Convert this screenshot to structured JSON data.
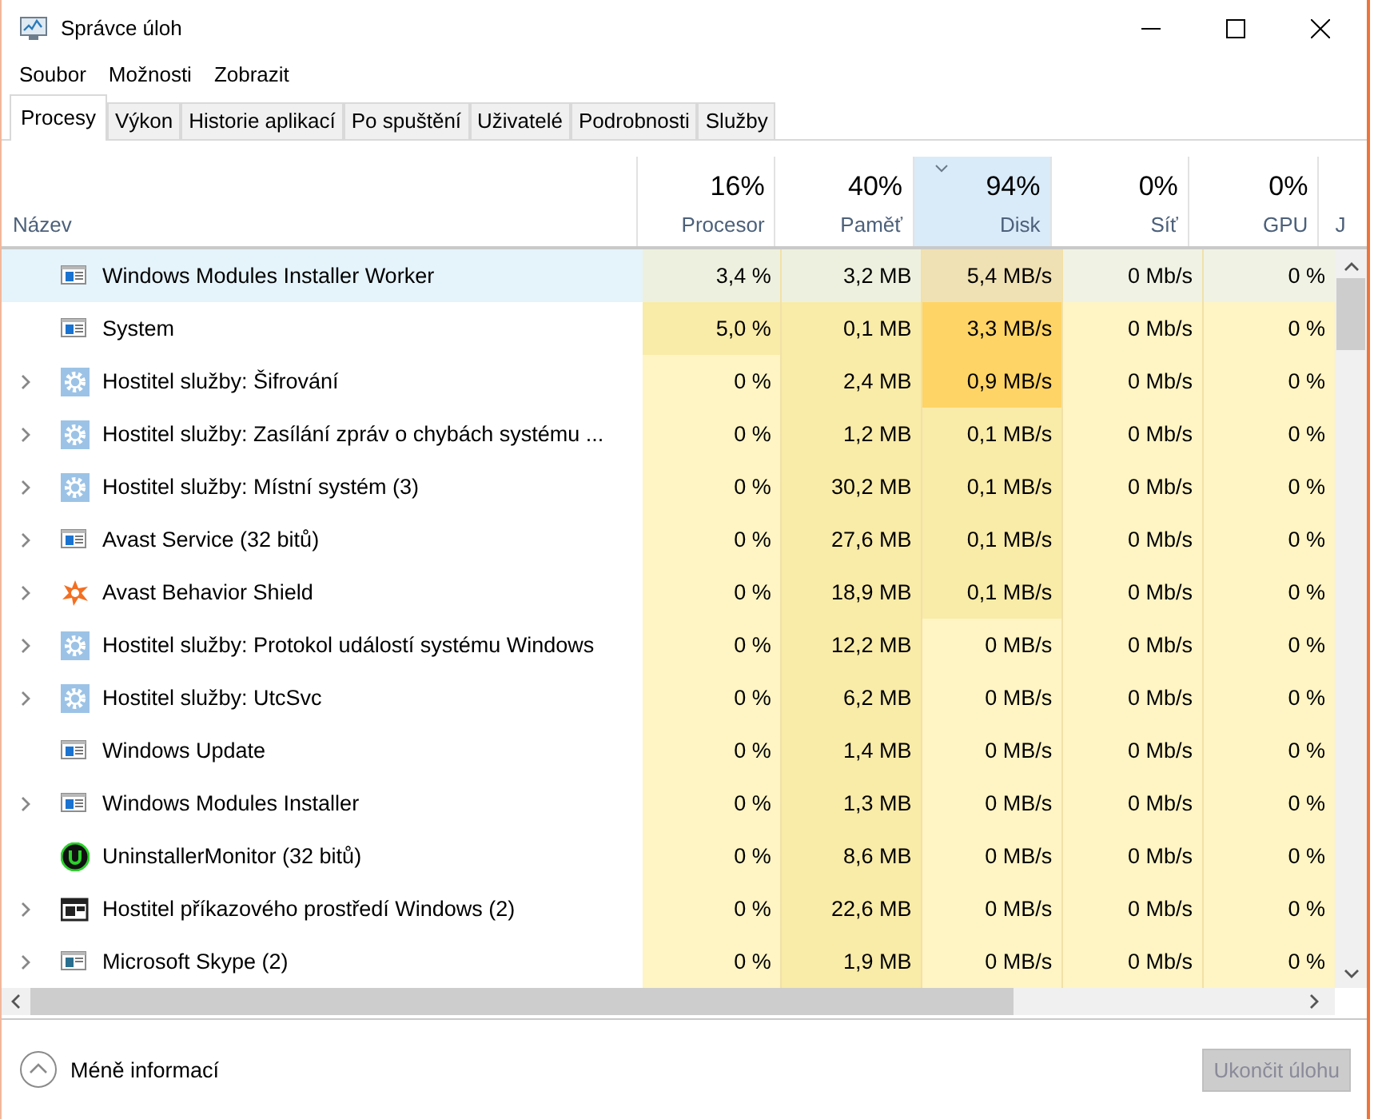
{
  "window": {
    "title": "Správce úloh"
  },
  "menu": [
    "Soubor",
    "Možnosti",
    "Zobrazit"
  ],
  "tabs": [
    {
      "label": "Procesy",
      "selected": true
    },
    {
      "label": "Výkon",
      "selected": false
    },
    {
      "label": "Historie aplikací",
      "selected": false
    },
    {
      "label": "Po spuštění",
      "selected": false
    },
    {
      "label": "Uživatelé",
      "selected": false
    },
    {
      "label": "Podrobnosti",
      "selected": false
    },
    {
      "label": "Služby",
      "selected": false
    }
  ],
  "table": {
    "name_column": "Název",
    "columns": [
      {
        "percent": "16%",
        "label": "Procesor",
        "sorted": false
      },
      {
        "percent": "40%",
        "label": "Paměť",
        "sorted": false
      },
      {
        "percent": "94%",
        "label": "Disk",
        "sorted": true
      },
      {
        "percent": "0%",
        "label": "Síť",
        "sorted": false
      },
      {
        "percent": "0%",
        "label": "GPU",
        "sorted": false
      }
    ],
    "column_7": "J",
    "rows": [
      {
        "name": "Windows Modules Installer Worker",
        "kind": "app",
        "expandable": false,
        "selected": true,
        "cells": [
          {
            "text": "3,4 %",
            "color": "#eef0df"
          },
          {
            "text": "3,2 MB",
            "color": "#eef0df"
          },
          {
            "text": "5,4 MB/s",
            "color": "#f0e1b4"
          },
          {
            "text": "0 Mb/s",
            "color": "#f0f2e4"
          },
          {
            "text": "0 %",
            "color": "#f0f2e4"
          }
        ]
      },
      {
        "name": "System",
        "kind": "app",
        "expandable": false,
        "selected": false,
        "cells": [
          {
            "text": "5,0 %",
            "color": "#f9eba8"
          },
          {
            "text": "0,1 MB",
            "color": "#f9eba8"
          },
          {
            "text": "3,3 MB/s",
            "color": "#ffd466"
          },
          {
            "text": "0 Mb/s",
            "color": "#fff4c4"
          },
          {
            "text": "0 %",
            "color": "#fff4c4"
          }
        ]
      },
      {
        "name": "Hostitel služby: Šifrování",
        "kind": "gear",
        "expandable": true,
        "selected": false,
        "cells": [
          {
            "text": "0 %",
            "color": "#fff4c4"
          },
          {
            "text": "2,4 MB",
            "color": "#f9eba8"
          },
          {
            "text": "0,9 MB/s",
            "color": "#ffd466"
          },
          {
            "text": "0 Mb/s",
            "color": "#fff4c4"
          },
          {
            "text": "0 %",
            "color": "#fff4c4"
          }
        ]
      },
      {
        "name": "Hostitel služby: Zasílání zpráv o chybách systému ...",
        "kind": "gear",
        "expandable": true,
        "selected": false,
        "cells": [
          {
            "text": "0 %",
            "color": "#fff4c4"
          },
          {
            "text": "1,2 MB",
            "color": "#f9eba8"
          },
          {
            "text": "0,1 MB/s",
            "color": "#f9eba8"
          },
          {
            "text": "0 Mb/s",
            "color": "#fff4c4"
          },
          {
            "text": "0 %",
            "color": "#fff4c4"
          }
        ]
      },
      {
        "name": "Hostitel služby: Místní systém (3)",
        "kind": "gear",
        "expandable": true,
        "selected": false,
        "cells": [
          {
            "text": "0 %",
            "color": "#fff4c4"
          },
          {
            "text": "30,2 MB",
            "color": "#f9eba8"
          },
          {
            "text": "0,1 MB/s",
            "color": "#f9eba8"
          },
          {
            "text": "0 Mb/s",
            "color": "#fff4c4"
          },
          {
            "text": "0 %",
            "color": "#fff4c4"
          }
        ]
      },
      {
        "name": "Avast Service (32 bitů)",
        "kind": "app",
        "expandable": true,
        "selected": false,
        "cells": [
          {
            "text": "0 %",
            "color": "#fff4c4"
          },
          {
            "text": "27,6 MB",
            "color": "#f9eba8"
          },
          {
            "text": "0,1 MB/s",
            "color": "#f9eba8"
          },
          {
            "text": "0 Mb/s",
            "color": "#fff4c4"
          },
          {
            "text": "0 %",
            "color": "#fff4c4"
          }
        ]
      },
      {
        "name": "Avast Behavior Shield",
        "kind": "avast",
        "expandable": true,
        "selected": false,
        "cells": [
          {
            "text": "0 %",
            "color": "#fff4c4"
          },
          {
            "text": "18,9 MB",
            "color": "#f9eba8"
          },
          {
            "text": "0,1 MB/s",
            "color": "#f9eba8"
          },
          {
            "text": "0 Mb/s",
            "color": "#fff4c4"
          },
          {
            "text": "0 %",
            "color": "#fff4c4"
          }
        ]
      },
      {
        "name": "Hostitel služby: Protokol událostí systému Windows",
        "kind": "gear",
        "expandable": true,
        "selected": false,
        "cells": [
          {
            "text": "0 %",
            "color": "#fff4c4"
          },
          {
            "text": "12,2 MB",
            "color": "#f9eba8"
          },
          {
            "text": "0 MB/s",
            "color": "#fff4c4"
          },
          {
            "text": "0 Mb/s",
            "color": "#fff4c4"
          },
          {
            "text": "0 %",
            "color": "#fff4c4"
          }
        ]
      },
      {
        "name": "Hostitel služby: UtcSvc",
        "kind": "gear",
        "expandable": true,
        "selected": false,
        "cells": [
          {
            "text": "0 %",
            "color": "#fff4c4"
          },
          {
            "text": "6,2 MB",
            "color": "#f9eba8"
          },
          {
            "text": "0 MB/s",
            "color": "#fff4c4"
          },
          {
            "text": "0 Mb/s",
            "color": "#fff4c4"
          },
          {
            "text": "0 %",
            "color": "#fff4c4"
          }
        ]
      },
      {
        "name": "Windows Update",
        "kind": "app",
        "expandable": false,
        "selected": false,
        "cells": [
          {
            "text": "0 %",
            "color": "#fff4c4"
          },
          {
            "text": "1,4 MB",
            "color": "#f9eba8"
          },
          {
            "text": "0 MB/s",
            "color": "#fff4c4"
          },
          {
            "text": "0 Mb/s",
            "color": "#fff4c4"
          },
          {
            "text": "0 %",
            "color": "#fff4c4"
          }
        ]
      },
      {
        "name": "Windows Modules Installer",
        "kind": "app",
        "expandable": true,
        "selected": false,
        "cells": [
          {
            "text": "0 %",
            "color": "#fff4c4"
          },
          {
            "text": "1,3 MB",
            "color": "#f9eba8"
          },
          {
            "text": "0 MB/s",
            "color": "#fff4c4"
          },
          {
            "text": "0 Mb/s",
            "color": "#fff4c4"
          },
          {
            "text": "0 %",
            "color": "#fff4c4"
          }
        ]
      },
      {
        "name": "UninstallerMonitor (32 bitů)",
        "kind": "uninstaller",
        "expandable": false,
        "selected": false,
        "cells": [
          {
            "text": "0 %",
            "color": "#fff4c4"
          },
          {
            "text": "8,6 MB",
            "color": "#f9eba8"
          },
          {
            "text": "0 MB/s",
            "color": "#fff4c4"
          },
          {
            "text": "0 Mb/s",
            "color": "#fff4c4"
          },
          {
            "text": "0 %",
            "color": "#fff4c4"
          }
        ]
      },
      {
        "name": "Hostitel příkazového prostředí Windows (2)",
        "kind": "console",
        "expandable": true,
        "selected": false,
        "cells": [
          {
            "text": "0 %",
            "color": "#fff4c4"
          },
          {
            "text": "22,6 MB",
            "color": "#f9eba8"
          },
          {
            "text": "0 MB/s",
            "color": "#fff4c4"
          },
          {
            "text": "0 Mb/s",
            "color": "#fff4c4"
          },
          {
            "text": "0 %",
            "color": "#fff4c4"
          }
        ]
      },
      {
        "name": "Microsoft Skype (2)",
        "kind": "skype",
        "expandable": true,
        "selected": false,
        "cells": [
          {
            "text": "0 %",
            "color": "#fff4c4"
          },
          {
            "text": "1,9 MB",
            "color": "#f9eba8"
          },
          {
            "text": "0 MB/s",
            "color": "#fff4c4"
          },
          {
            "text": "0 Mb/s",
            "color": "#fff4c4"
          },
          {
            "text": "0 %",
            "color": "#fff4c4"
          }
        ]
      }
    ]
  },
  "footer": {
    "toggle": "Méně informací",
    "end_task": {
      "label": "Ukončit úlohu",
      "disabled": true
    }
  }
}
